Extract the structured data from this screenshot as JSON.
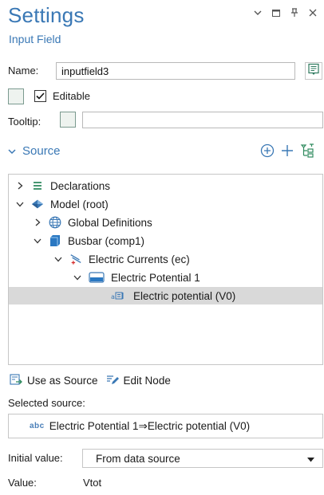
{
  "header": {
    "title": "Settings",
    "subtitle": "Input Field"
  },
  "form": {
    "name_label": "Name:",
    "name_value": "inputfield3",
    "editable_label": "Editable",
    "editable_checked": true,
    "tooltip_label": "Tooltip:",
    "tooltip_value": ""
  },
  "source": {
    "section_title": "Source",
    "tree": [
      {
        "label": "Declarations",
        "expanded": false,
        "icon": "declarations-icon"
      },
      {
        "label": "Model (root)",
        "expanded": true,
        "icon": "model-root-icon"
      },
      {
        "label": "Global Definitions",
        "expanded": false,
        "icon": "globe-icon"
      },
      {
        "label": "Busbar (comp1)",
        "expanded": true,
        "icon": "component-icon"
      },
      {
        "label": "Electric Currents (ec)",
        "expanded": true,
        "icon": "electric-currents-icon"
      },
      {
        "label": "Electric Potential 1",
        "expanded": true,
        "icon": "boundary-condition-icon"
      },
      {
        "label": "Electric potential (V0)",
        "selected": true,
        "icon": "input-field-icon"
      }
    ],
    "use_as_source_label": "Use as Source",
    "edit_node_label": "Edit Node",
    "selected_source_label": "Selected source:",
    "selected_source_badge": "abc",
    "selected_source_value": "Electric Potential 1⇒Electric potential (V0)"
  },
  "initial_value": {
    "label": "Initial value:",
    "selected": "From data source"
  },
  "value": {
    "label": "Value:",
    "text": "Vtot"
  },
  "colors": {
    "accent": "#3a78b5",
    "selection": "#d9d9d9",
    "border": "#c6c6c6"
  }
}
